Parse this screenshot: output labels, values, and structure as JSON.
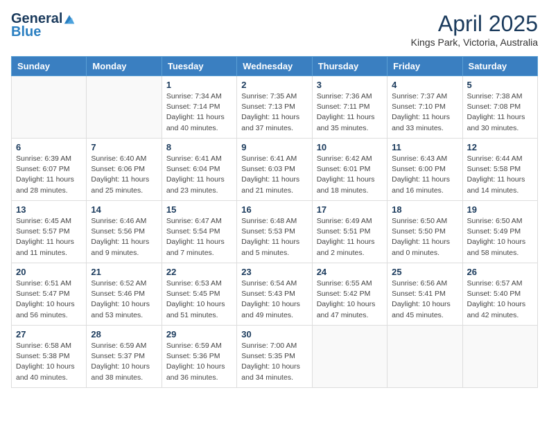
{
  "header": {
    "logo_general": "General",
    "logo_blue": "Blue",
    "month_year": "April 2025",
    "location": "Kings Park, Victoria, Australia"
  },
  "days_of_week": [
    "Sunday",
    "Monday",
    "Tuesday",
    "Wednesday",
    "Thursday",
    "Friday",
    "Saturday"
  ],
  "weeks": [
    [
      {
        "day": "",
        "info": ""
      },
      {
        "day": "",
        "info": ""
      },
      {
        "day": "1",
        "info": "Sunrise: 7:34 AM\nSunset: 7:14 PM\nDaylight: 11 hours and 40 minutes."
      },
      {
        "day": "2",
        "info": "Sunrise: 7:35 AM\nSunset: 7:13 PM\nDaylight: 11 hours and 37 minutes."
      },
      {
        "day": "3",
        "info": "Sunrise: 7:36 AM\nSunset: 7:11 PM\nDaylight: 11 hours and 35 minutes."
      },
      {
        "day": "4",
        "info": "Sunrise: 7:37 AM\nSunset: 7:10 PM\nDaylight: 11 hours and 33 minutes."
      },
      {
        "day": "5",
        "info": "Sunrise: 7:38 AM\nSunset: 7:08 PM\nDaylight: 11 hours and 30 minutes."
      }
    ],
    [
      {
        "day": "6",
        "info": "Sunrise: 6:39 AM\nSunset: 6:07 PM\nDaylight: 11 hours and 28 minutes."
      },
      {
        "day": "7",
        "info": "Sunrise: 6:40 AM\nSunset: 6:06 PM\nDaylight: 11 hours and 25 minutes."
      },
      {
        "day": "8",
        "info": "Sunrise: 6:41 AM\nSunset: 6:04 PM\nDaylight: 11 hours and 23 minutes."
      },
      {
        "day": "9",
        "info": "Sunrise: 6:41 AM\nSunset: 6:03 PM\nDaylight: 11 hours and 21 minutes."
      },
      {
        "day": "10",
        "info": "Sunrise: 6:42 AM\nSunset: 6:01 PM\nDaylight: 11 hours and 18 minutes."
      },
      {
        "day": "11",
        "info": "Sunrise: 6:43 AM\nSunset: 6:00 PM\nDaylight: 11 hours and 16 minutes."
      },
      {
        "day": "12",
        "info": "Sunrise: 6:44 AM\nSunset: 5:58 PM\nDaylight: 11 hours and 14 minutes."
      }
    ],
    [
      {
        "day": "13",
        "info": "Sunrise: 6:45 AM\nSunset: 5:57 PM\nDaylight: 11 hours and 11 minutes."
      },
      {
        "day": "14",
        "info": "Sunrise: 6:46 AM\nSunset: 5:56 PM\nDaylight: 11 hours and 9 minutes."
      },
      {
        "day": "15",
        "info": "Sunrise: 6:47 AM\nSunset: 5:54 PM\nDaylight: 11 hours and 7 minutes."
      },
      {
        "day": "16",
        "info": "Sunrise: 6:48 AM\nSunset: 5:53 PM\nDaylight: 11 hours and 5 minutes."
      },
      {
        "day": "17",
        "info": "Sunrise: 6:49 AM\nSunset: 5:51 PM\nDaylight: 11 hours and 2 minutes."
      },
      {
        "day": "18",
        "info": "Sunrise: 6:50 AM\nSunset: 5:50 PM\nDaylight: 11 hours and 0 minutes."
      },
      {
        "day": "19",
        "info": "Sunrise: 6:50 AM\nSunset: 5:49 PM\nDaylight: 10 hours and 58 minutes."
      }
    ],
    [
      {
        "day": "20",
        "info": "Sunrise: 6:51 AM\nSunset: 5:47 PM\nDaylight: 10 hours and 56 minutes."
      },
      {
        "day": "21",
        "info": "Sunrise: 6:52 AM\nSunset: 5:46 PM\nDaylight: 10 hours and 53 minutes."
      },
      {
        "day": "22",
        "info": "Sunrise: 6:53 AM\nSunset: 5:45 PM\nDaylight: 10 hours and 51 minutes."
      },
      {
        "day": "23",
        "info": "Sunrise: 6:54 AM\nSunset: 5:43 PM\nDaylight: 10 hours and 49 minutes."
      },
      {
        "day": "24",
        "info": "Sunrise: 6:55 AM\nSunset: 5:42 PM\nDaylight: 10 hours and 47 minutes."
      },
      {
        "day": "25",
        "info": "Sunrise: 6:56 AM\nSunset: 5:41 PM\nDaylight: 10 hours and 45 minutes."
      },
      {
        "day": "26",
        "info": "Sunrise: 6:57 AM\nSunset: 5:40 PM\nDaylight: 10 hours and 42 minutes."
      }
    ],
    [
      {
        "day": "27",
        "info": "Sunrise: 6:58 AM\nSunset: 5:38 PM\nDaylight: 10 hours and 40 minutes."
      },
      {
        "day": "28",
        "info": "Sunrise: 6:59 AM\nSunset: 5:37 PM\nDaylight: 10 hours and 38 minutes."
      },
      {
        "day": "29",
        "info": "Sunrise: 6:59 AM\nSunset: 5:36 PM\nDaylight: 10 hours and 36 minutes."
      },
      {
        "day": "30",
        "info": "Sunrise: 7:00 AM\nSunset: 5:35 PM\nDaylight: 10 hours and 34 minutes."
      },
      {
        "day": "",
        "info": ""
      },
      {
        "day": "",
        "info": ""
      },
      {
        "day": "",
        "info": ""
      }
    ]
  ]
}
